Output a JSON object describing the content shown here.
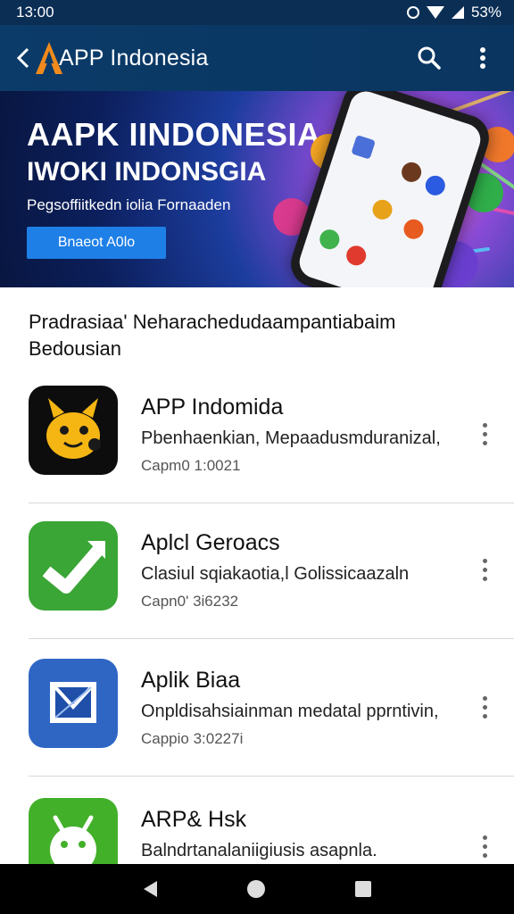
{
  "status_bar": {
    "time": "13:00",
    "battery": "53%"
  },
  "app_bar": {
    "back_symbol": "<",
    "title": "APP Indonesia",
    "icons": [
      "back-icon",
      "logo-icon",
      "search-icon",
      "more-vert-icon"
    ]
  },
  "banner": {
    "line1": "AAPK IINDONESIA",
    "line2": "IWOKI INDONSGIA",
    "subtitle": "Pegsoffiitkedn iolia Fornaaden",
    "button": "Bnaeot A0lo"
  },
  "section": {
    "title": "Pradrasiaa' Neharachedudaampantiabaim Bedousian"
  },
  "apps": [
    {
      "name": "APP Indomida",
      "description": "Pbenhaenkian, Mepaadusmduranizal,",
      "meta": "Capm0  1:0021",
      "icon": "cartoon-creature-icon",
      "icon_color": "#f5b614"
    },
    {
      "name": "Aplcl Geroacs",
      "description": "Clasiul sqiakaotia,l Golissicaazaln",
      "meta": "Capn0' 3i6232",
      "icon": "checkmark-arrow-icon",
      "icon_color": "#3aa635"
    },
    {
      "name": "Aplik Biaa",
      "description": "Onpldisahsiainman medatal pprntivin,",
      "meta": "Cappio  3:0227i",
      "icon": "mail-icon",
      "icon_color": "#2f66c4"
    },
    {
      "name": "ARP& Hsk",
      "description": "Balndrtanalaniigiusis asapnla.",
      "meta": "",
      "icon": "android-icon",
      "icon_color": "#43b02a"
    }
  ],
  "colors": {
    "app_bar": "#0b3b69",
    "status_bar": "#0b2e55",
    "accent_button": "#1e7fe6",
    "nav_bar": "#000000"
  }
}
